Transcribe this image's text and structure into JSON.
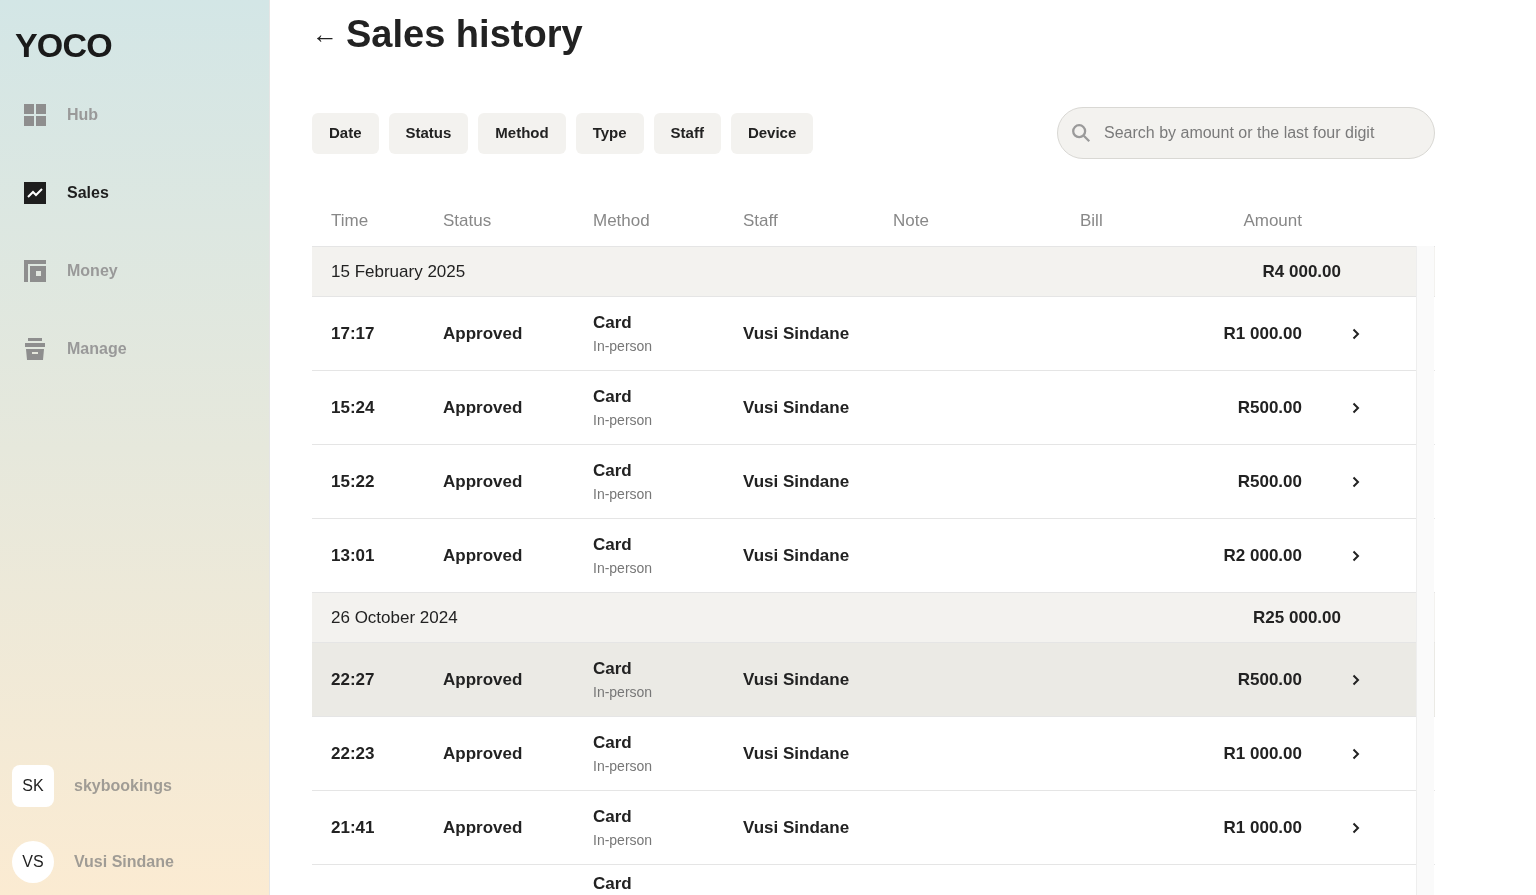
{
  "sidebar": {
    "logo": "YOCO",
    "items": [
      {
        "label": "Hub",
        "selected": false
      },
      {
        "label": "Sales",
        "selected": true
      },
      {
        "label": "Money",
        "selected": false
      },
      {
        "label": "Manage",
        "selected": false
      }
    ],
    "accounts": [
      {
        "initials": "SK",
        "name": "skybookings",
        "kind": "business"
      },
      {
        "initials": "VS",
        "name": "Vusi Sindane",
        "kind": "user"
      }
    ]
  },
  "page": {
    "back": "←",
    "title": "Sales history"
  },
  "filters": [
    "Date",
    "Status",
    "Method",
    "Type",
    "Staff",
    "Device"
  ],
  "search": {
    "placeholder": "Search by amount or the last four digit"
  },
  "table": {
    "columns": [
      "Time",
      "Status",
      "Method",
      "Staff",
      "Note",
      "Bill",
      "Amount"
    ],
    "groups": [
      {
        "date": "15 February 2025",
        "total": "R4 000.00",
        "rows": [
          {
            "time": "17:17",
            "status": "Approved",
            "method": "Card",
            "method_detail": "In-person",
            "staff": "Vusi Sindane",
            "amount": "R1 000.00",
            "highlighted": false
          },
          {
            "time": "15:24",
            "status": "Approved",
            "method": "Card",
            "method_detail": "In-person",
            "staff": "Vusi Sindane",
            "amount": "R500.00",
            "highlighted": false
          },
          {
            "time": "15:22",
            "status": "Approved",
            "method": "Card",
            "method_detail": "In-person",
            "staff": "Vusi Sindane",
            "amount": "R500.00",
            "highlighted": false
          },
          {
            "time": "13:01",
            "status": "Approved",
            "method": "Card",
            "method_detail": "In-person",
            "staff": "Vusi Sindane",
            "amount": "R2 000.00",
            "highlighted": false
          }
        ]
      },
      {
        "date": "26 October 2024",
        "total": "R25 000.00",
        "rows": [
          {
            "time": "22:27",
            "status": "Approved",
            "method": "Card",
            "method_detail": "In-person",
            "staff": "Vusi Sindane",
            "amount": "R500.00",
            "highlighted": true
          },
          {
            "time": "22:23",
            "status": "Approved",
            "method": "Card",
            "method_detail": "In-person",
            "staff": "Vusi Sindane",
            "amount": "R1 000.00",
            "highlighted": false
          },
          {
            "time": "21:41",
            "status": "Approved",
            "method": "Card",
            "method_detail": "In-person",
            "staff": "Vusi Sindane",
            "amount": "R1 000.00",
            "highlighted": false
          },
          {
            "method": "Card",
            "highlighted": false
          }
        ]
      }
    ]
  }
}
